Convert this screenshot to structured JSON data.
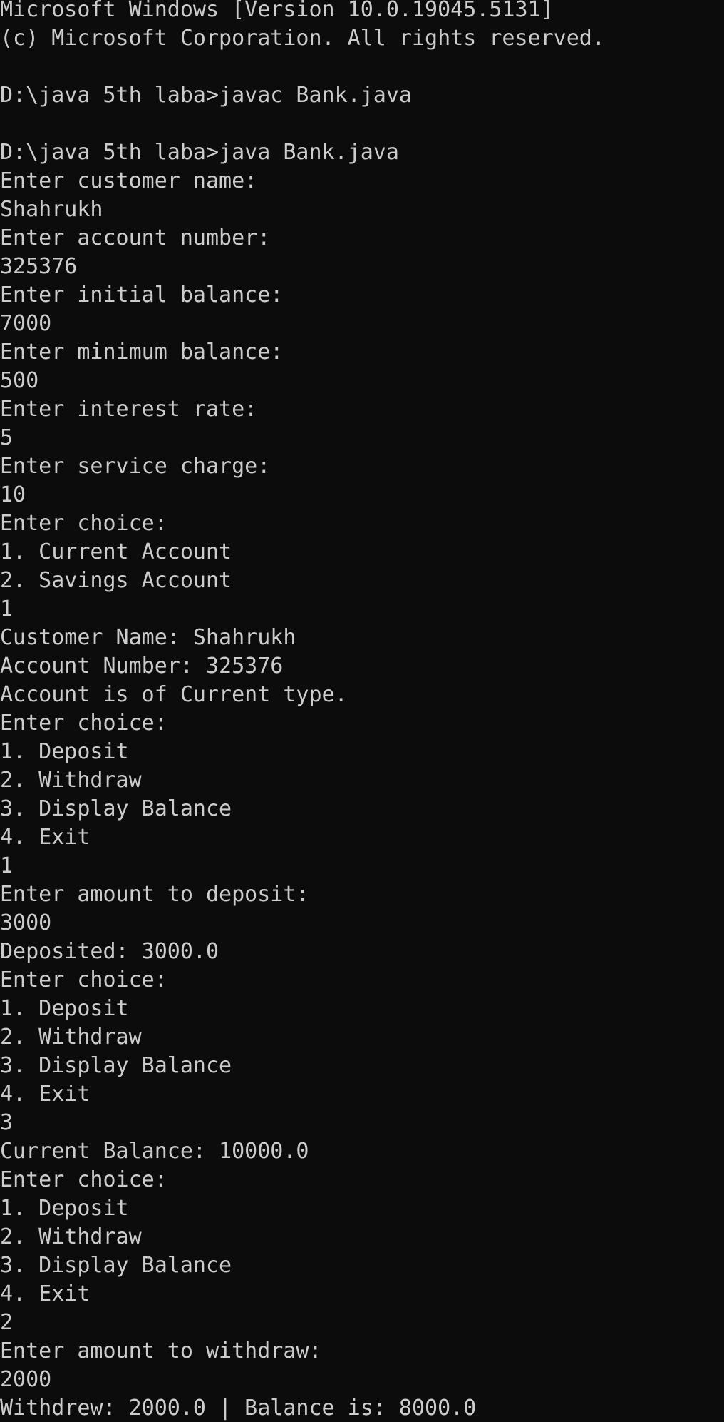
{
  "window": {
    "background": "#0c0c0c",
    "foreground": "#cccccc"
  },
  "console": {
    "lines": [
      "Microsoft Windows [Version 10.0.19045.5131]",
      "(c) Microsoft Corporation. All rights reserved.",
      "",
      "D:\\java 5th laba>javac Bank.java",
      "",
      "D:\\java 5th laba>java Bank.java",
      "Enter customer name:",
      "Shahrukh",
      "Enter account number:",
      "325376",
      "Enter initial balance:",
      "7000",
      "Enter minimum balance:",
      "500",
      "Enter interest rate:",
      "5",
      "Enter service charge:",
      "10",
      "Enter choice:",
      "1. Current Account",
      "2. Savings Account",
      "1",
      "Customer Name: Shahrukh",
      "Account Number: 325376",
      "Account is of Current type.",
      "Enter choice:",
      "1. Deposit",
      "2. Withdraw",
      "3. Display Balance",
      "4. Exit",
      "1",
      "Enter amount to deposit:",
      "3000",
      "Deposited: 3000.0",
      "Enter choice:",
      "1. Deposit",
      "2. Withdraw",
      "3. Display Balance",
      "4. Exit",
      "3",
      "Current Balance: 10000.0",
      "Enter choice:",
      "1. Deposit",
      "2. Withdraw",
      "3. Display Balance",
      "4. Exit",
      "2",
      "Enter amount to withdraw:",
      "2000",
      "Withdrew: 2000.0 | Balance is: 8000.0"
    ]
  }
}
